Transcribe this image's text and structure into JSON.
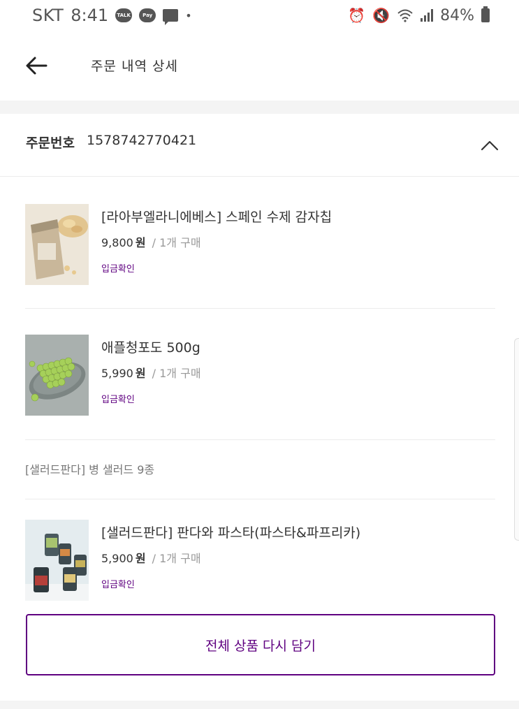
{
  "status_bar": {
    "carrier": "SKT",
    "time": "8:41",
    "talk_badge": "TALK",
    "pay_badge": "Pay",
    "battery": "84%"
  },
  "header": {
    "title": "주문 내역 상세"
  },
  "order": {
    "number_label": "주문번호",
    "number": "1578742770421"
  },
  "items": [
    {
      "name": "[라아부엘라니에베스] 스페인 수제 감자칩",
      "price": "9,800",
      "currency": "원",
      "qty": "/ 1개 구매",
      "status": "입금확인",
      "thumb": "potato-chip-bag-icon"
    },
    {
      "name": "애플청포도 500g",
      "price": "5,990",
      "currency": "원",
      "qty": "/ 1개 구매",
      "status": "입금확인",
      "thumb": "green-grapes-icon"
    },
    {
      "name": "[샐러드판다] 판다와 파스타(파스타&파프리카)",
      "price": "5,900",
      "currency": "원",
      "qty": "/ 1개 구매",
      "status": "입금확인",
      "thumb": "salad-jars-icon"
    }
  ],
  "group_label": "[샐러드판다] 병 샐러드 9종",
  "reorder_button": "전체 상품 다시 담기",
  "colors": {
    "accent": "#5f0080",
    "background": "#f4f4f4",
    "card": "#ffffff"
  }
}
